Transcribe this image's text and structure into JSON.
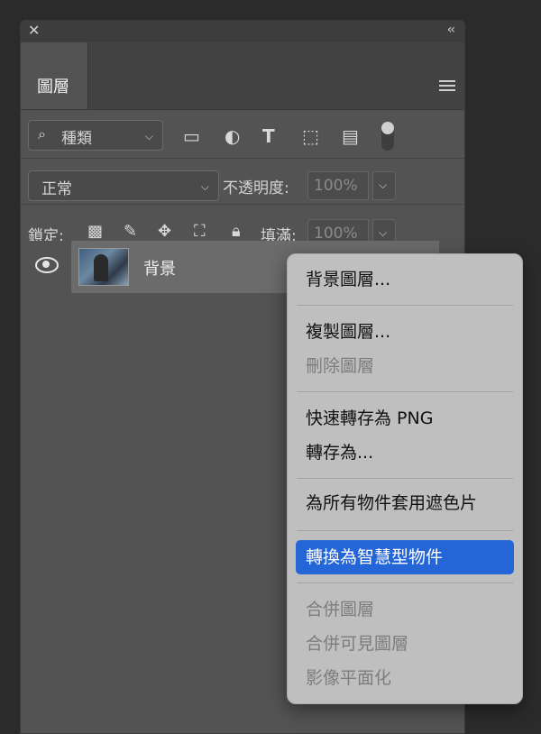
{
  "panel": {
    "tab_label": "圖層",
    "filter": {
      "selected": "種類"
    },
    "blend_mode": "正常",
    "opacity_label": "不透明度:",
    "opacity_value": "100%",
    "lock_label": "鎖定:",
    "fill_label": "填滿:",
    "fill_value": "100%"
  },
  "layers": [
    {
      "name": "背景",
      "visible": true
    }
  ],
  "context_menu": {
    "groups": [
      [
        {
          "label": "背景圖層...",
          "enabled": true
        }
      ],
      [
        {
          "label": "複製圖層...",
          "enabled": true
        },
        {
          "label": "刪除圖層",
          "enabled": false
        }
      ],
      [
        {
          "label": "快速轉存為 PNG",
          "enabled": true
        },
        {
          "label": "轉存為...",
          "enabled": true
        }
      ],
      [
        {
          "label": "為所有物件套用遮色片",
          "enabled": true
        }
      ],
      [
        {
          "label": "轉換為智慧型物件",
          "enabled": true,
          "highlighted": true
        }
      ],
      [
        {
          "label": "合併圖層",
          "enabled": false
        },
        {
          "label": "合併可見圖層",
          "enabled": false
        },
        {
          "label": "影像平面化",
          "enabled": false
        }
      ]
    ]
  },
  "colors": {
    "panel_bg": "#535353",
    "highlight": "#2466d7",
    "menu_bg": "#bfbfbf"
  }
}
